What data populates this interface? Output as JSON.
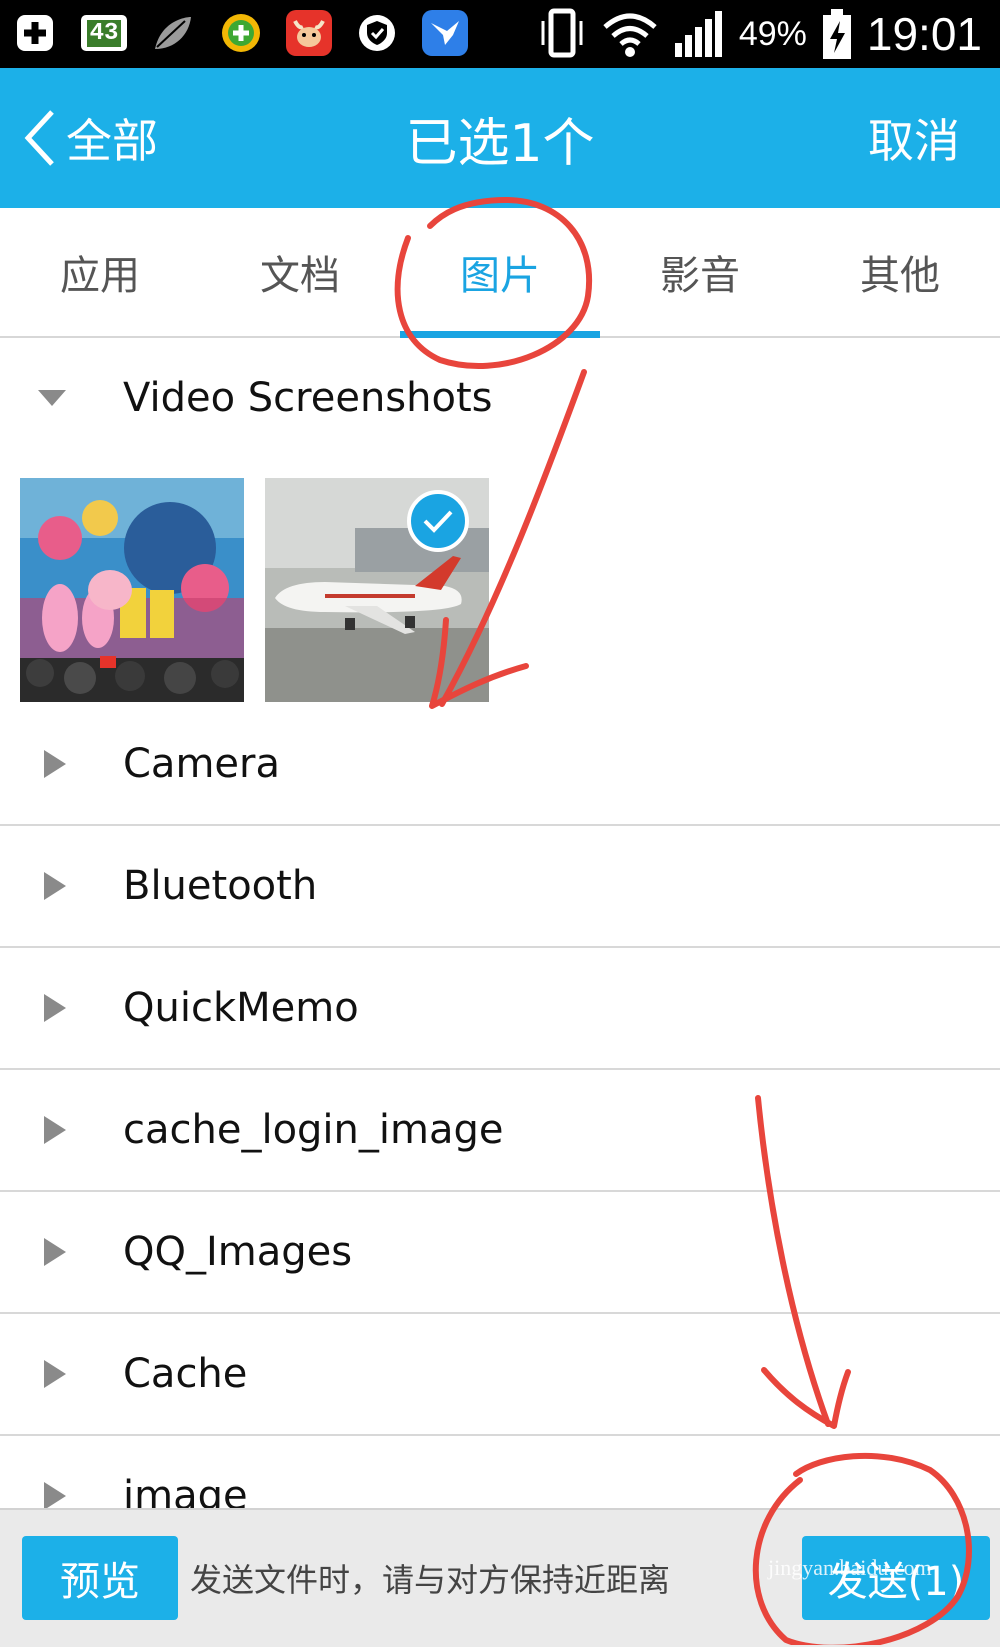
{
  "status_bar": {
    "icons": [
      "add-icon",
      "battery-badge-icon",
      "leaf-icon",
      "plus-coin-icon",
      "cow-icon",
      "shield-icon",
      "bird-icon"
    ],
    "badge_number": "43",
    "right_icons": [
      "vibrate-icon",
      "wifi-icon",
      "signal-icon",
      "battery-charging-icon"
    ],
    "battery": "49%",
    "time": "19:01"
  },
  "title_bar": {
    "back_label": "全部",
    "title": "已选1个",
    "cancel_label": "取消",
    "color": "#1cb0e8"
  },
  "tabs": [
    {
      "label": "应用",
      "active": false
    },
    {
      "label": "文档",
      "active": false
    },
    {
      "label": "图片",
      "active": true
    },
    {
      "label": "影音",
      "active": false
    },
    {
      "label": "其他",
      "active": false
    }
  ],
  "folders": [
    {
      "name": "Video Screenshots",
      "expanded": true
    },
    {
      "name": "Camera",
      "expanded": false
    },
    {
      "name": "Bluetooth",
      "expanded": false
    },
    {
      "name": "QuickMemo",
      "expanded": false
    },
    {
      "name": "cache_login_image",
      "expanded": false
    },
    {
      "name": "QQ_Images",
      "expanded": false
    },
    {
      "name": "Cache",
      "expanded": false
    },
    {
      "name": "image",
      "expanded": false
    }
  ],
  "thumbnails": [
    {
      "name": "stage-performance-photo",
      "selected": false
    },
    {
      "name": "airplane-photo",
      "selected": true
    }
  ],
  "bottom_bar": {
    "preview_label": "预览",
    "hint": "发送文件时，请与对方保持近距离",
    "send_label": "发送(1)"
  },
  "watermark": "jingyan.baidu.com",
  "annotation_color": "#e8453c",
  "accent_color": "#1aa4e2"
}
